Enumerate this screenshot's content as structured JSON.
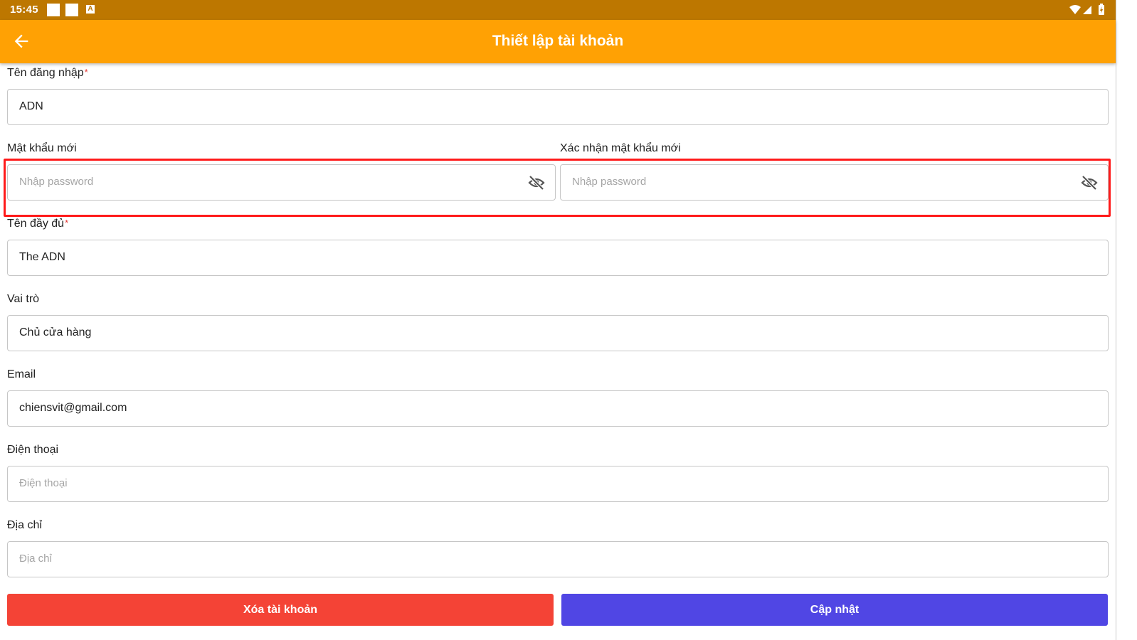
{
  "status_bar": {
    "time": "15:45",
    "notification_letter": "A"
  },
  "header": {
    "title": "Thiết lập tài khoản"
  },
  "form": {
    "username": {
      "label": "Tên đăng nhập",
      "required": "*",
      "value": "ADN"
    },
    "new_password": {
      "label": "Mật khẩu mới",
      "placeholder": "Nhập password"
    },
    "confirm_password": {
      "label": "Xác nhận mật khẩu mới",
      "placeholder": "Nhập password"
    },
    "full_name": {
      "label": "Tên đầy đủ",
      "required": "*",
      "value": "The ADN"
    },
    "role": {
      "label": "Vai trò",
      "value": "Chủ cửa hàng"
    },
    "email": {
      "label": "Email",
      "value": "chiensvit@gmail.com"
    },
    "phone": {
      "label": "Điện thoại",
      "placeholder": "Điện thoại"
    },
    "address": {
      "label": "Địa chỉ",
      "placeholder": "Địa chỉ"
    }
  },
  "actions": {
    "delete_label": "Xóa tài khoản",
    "update_label": "Cập nhật"
  },
  "colors": {
    "status_bar": "#bd7700",
    "app_bar": "#ffa104",
    "delete_button": "#f44336",
    "update_button": "#5046e4",
    "highlight": "#ff1a1a"
  },
  "icons": {
    "back": "arrow-left-icon",
    "password_toggle": "eye-off-icon",
    "wifi": "wifi-icon",
    "signal": "signal-icon",
    "battery": "battery-icon"
  }
}
